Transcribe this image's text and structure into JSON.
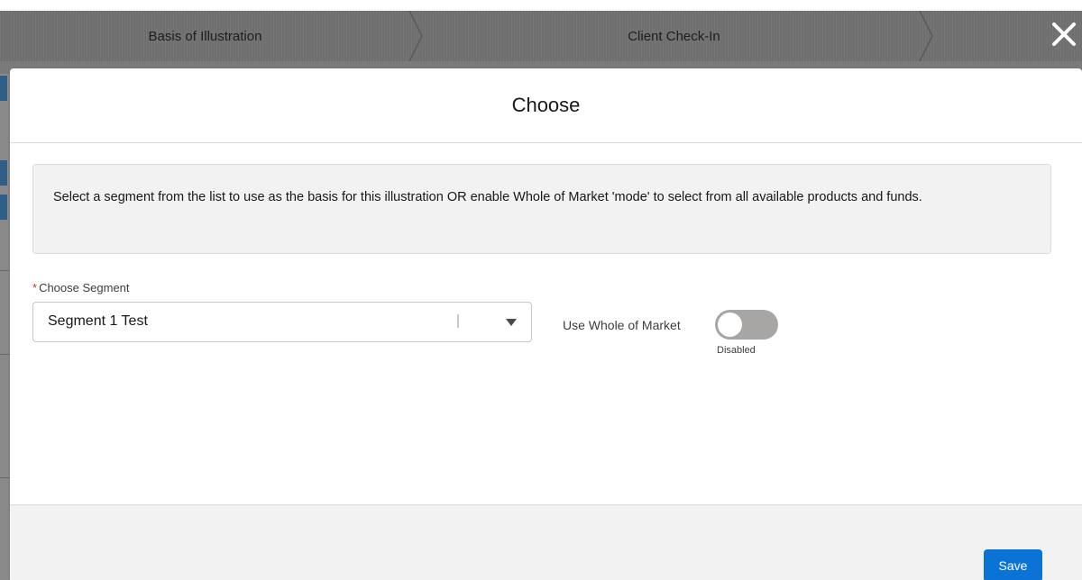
{
  "path": {
    "steps": [
      "Basis of Illustration",
      "Client Check-In"
    ]
  },
  "modal": {
    "title": "Choose",
    "info_text": "Select a segment from the list to use as the basis for this illustration OR enable Whole of Market 'mode' to select from all available products and funds.",
    "segment_field": {
      "label": "Choose Segment",
      "required_marker": "*",
      "value": "Segment 1 Test"
    },
    "whole_of_market": {
      "label": "Use Whole of Market",
      "status": "Disabled",
      "enabled": false
    },
    "save_label": "Save"
  },
  "icons": {
    "close": "close-icon",
    "dropdown": "caret-down-icon"
  },
  "colors": {
    "primary_button": "#0b72d6",
    "required": "#c23934",
    "toggle_off": "#a8a6a5"
  }
}
